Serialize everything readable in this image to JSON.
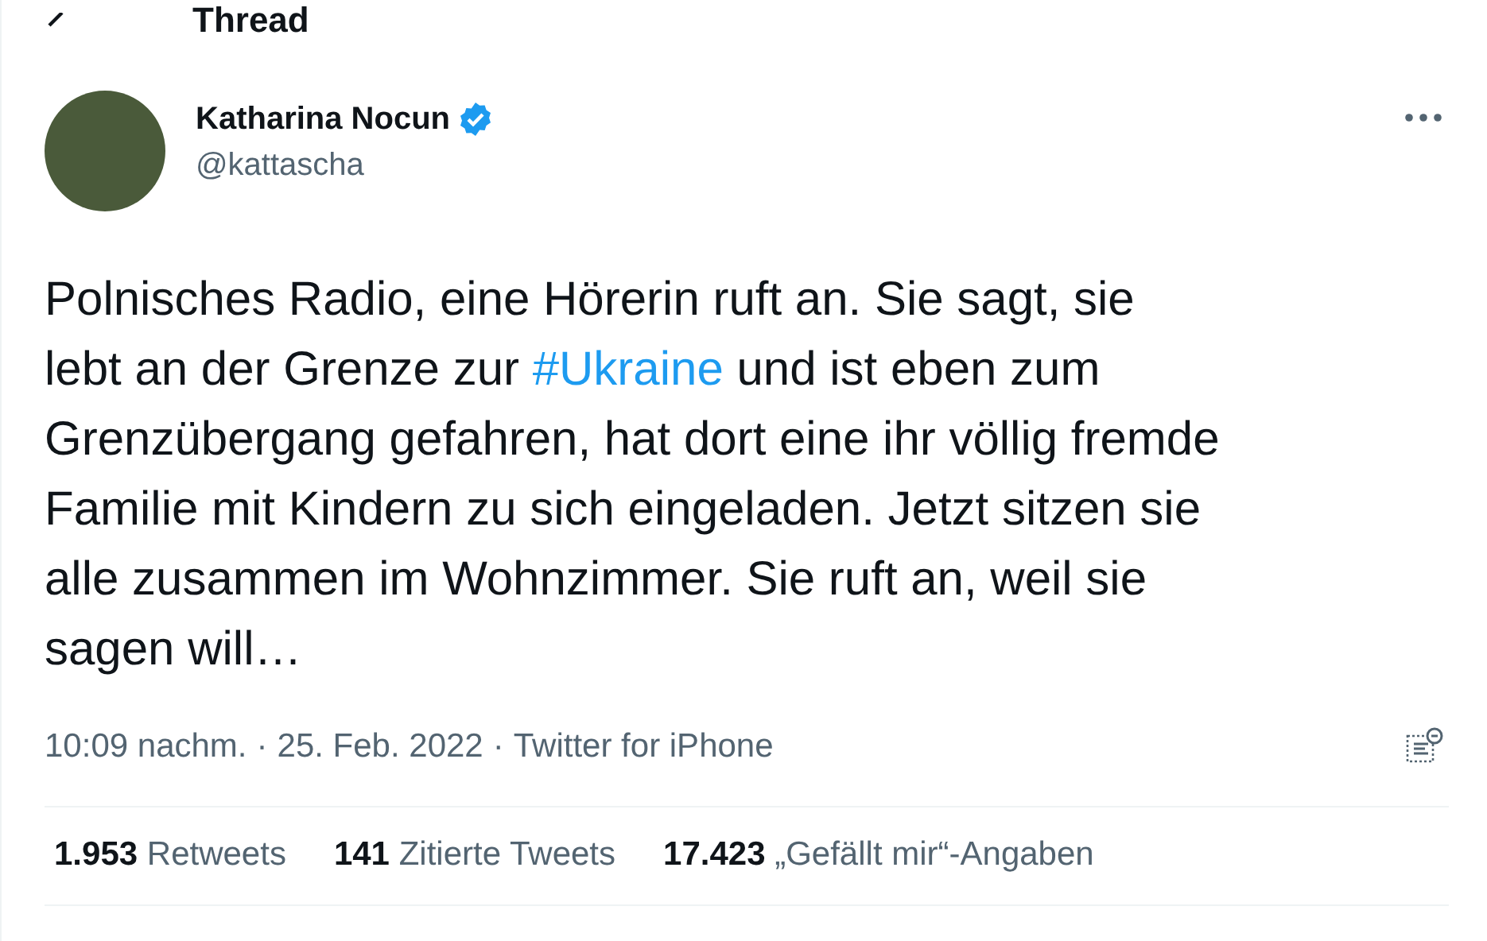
{
  "header": {
    "title": "Thread"
  },
  "tweet": {
    "author": {
      "name": "Katharina Nocun",
      "handle": "@kattascha",
      "verified": true
    },
    "lines": [
      [
        {
          "kind": "text",
          "text": "Polnisches Radio, eine Hörerin ruft an. Sie sagt, sie"
        }
      ],
      [
        {
          "kind": "text",
          "text": "lebt an der Grenze zur "
        },
        {
          "kind": "hashtag",
          "text": "#Ukraine"
        },
        {
          "kind": "text",
          "text": " und ist eben zum"
        }
      ],
      [
        {
          "kind": "text",
          "text": "Grenzübergang gefahren, hat dort eine ihr völlig fremde"
        }
      ],
      [
        {
          "kind": "text",
          "text": "Familie mit Kindern zu sich eingeladen. Jetzt sitzen sie"
        }
      ],
      [
        {
          "kind": "text",
          "text": "alle zusammen im Wohnzimmer. Sie ruft an, weil sie"
        }
      ],
      [
        {
          "kind": "text",
          "text": "sagen will…"
        }
      ]
    ],
    "meta": {
      "separator": "·",
      "items": [
        "10:09 nachm.",
        "25. Feb. 2022",
        "Twitter for iPhone"
      ]
    },
    "stats": [
      {
        "count": "1.953",
        "label": "Retweets"
      },
      {
        "count": "141",
        "label": "Zitierte Tweets"
      },
      {
        "count": "17.423",
        "label": "„Gefällt mir“-Angaben"
      }
    ]
  }
}
